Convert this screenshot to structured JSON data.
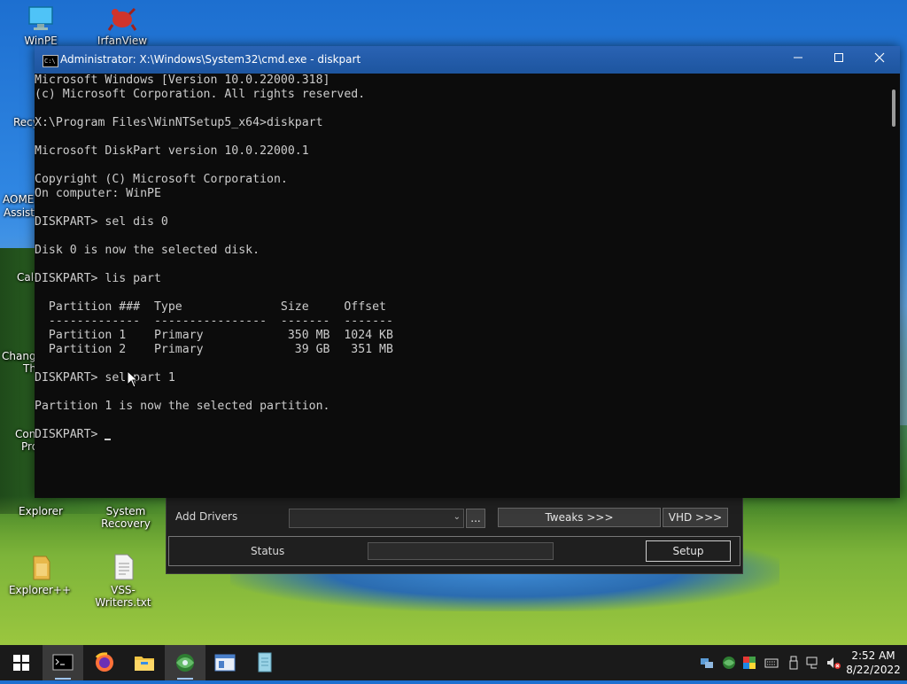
{
  "desktop": {
    "icons": [
      {
        "label": "WinPE"
      },
      {
        "label": "IrfanView"
      },
      {
        "label": "Explorer"
      },
      {
        "label": "System Recovery"
      },
      {
        "label": "Explorer++"
      },
      {
        "label": "VSS-Writers.txt"
      }
    ],
    "partial_labels": [
      "Recy",
      "AOMEI",
      "Assista",
      "Calc",
      "Change",
      "Th",
      "Con",
      "Pro"
    ]
  },
  "setup_window": {
    "add_drivers_label": "Add Drivers",
    "browse_label": "...",
    "tweaks_label": "Tweaks >>>",
    "vhd_label": "VHD >>>",
    "status_label": "Status",
    "setup_label": "Setup"
  },
  "cmd_window": {
    "title": "Administrator: X:\\Windows\\System32\\cmd.exe - diskpart",
    "lines": [
      "Microsoft Windows [Version 10.0.22000.318]",
      "(c) Microsoft Corporation. All rights reserved.",
      "",
      "X:\\Program Files\\WinNTSetup5_x64>diskpart",
      "",
      "Microsoft DiskPart version 10.0.22000.1",
      "",
      "Copyright (C) Microsoft Corporation.",
      "On computer: WinPE",
      "",
      "DISKPART> sel dis 0",
      "",
      "Disk 0 is now the selected disk.",
      "",
      "DISKPART> lis part",
      "",
      "  Partition ###  Type              Size     Offset",
      "  -------------  ----------------  -------  -------",
      "  Partition 1    Primary            350 MB  1024 KB",
      "  Partition 2    Primary             39 GB   351 MB",
      "",
      "DISKPART> sel part 1",
      "",
      "Partition 1 is now the selected partition.",
      "",
      "DISKPART> "
    ]
  },
  "taskbar": {
    "items": [
      "start-icon",
      "cmd-icon",
      "firefox-icon",
      "file-explorer-icon",
      "winntsetup-icon",
      "window-app-icon",
      "notepad-app-icon"
    ],
    "clock_time": "2:52 AM",
    "clock_date": "8/22/2022"
  },
  "colors": {
    "titlebar": "#1d559f",
    "console_bg": "#0c0c0c",
    "console_fg": "#cccccc",
    "taskbar": "#1a1a1a"
  }
}
